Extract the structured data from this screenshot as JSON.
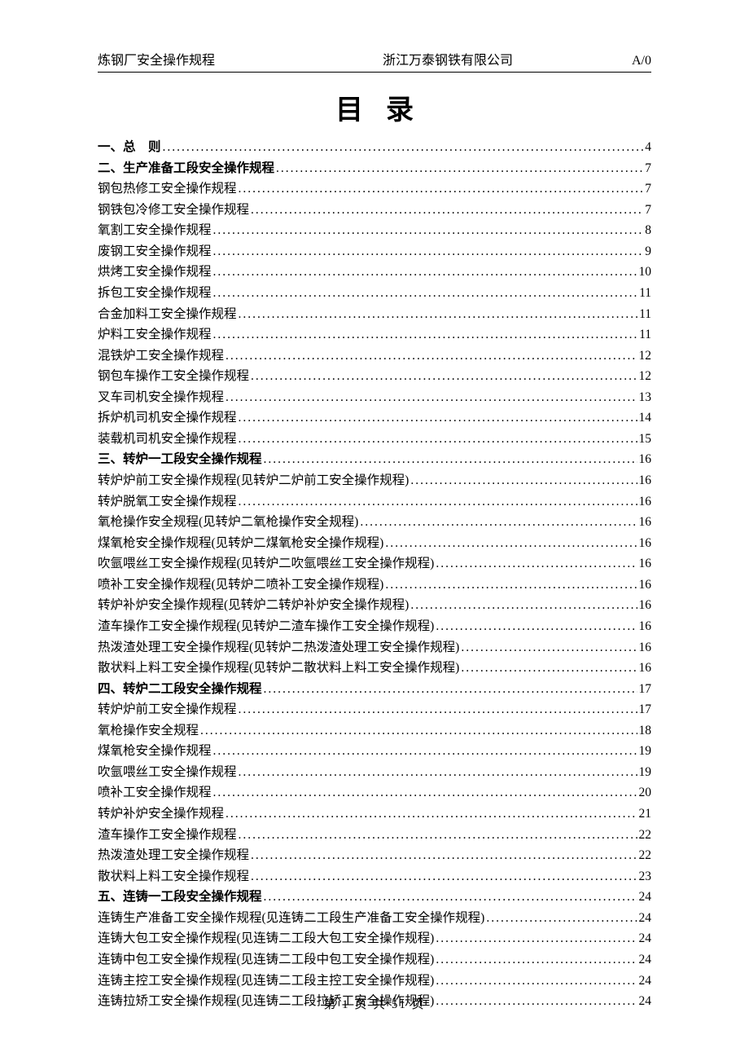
{
  "header": {
    "left": "炼钢厂安全操作规程",
    "center": "浙江万泰钢铁有限公司",
    "right": "A/0"
  },
  "title": "目录",
  "toc": [
    {
      "text": "一、总　则",
      "page": "4",
      "bold": true
    },
    {
      "text": "二、生产准备工段安全操作规程",
      "page": "7",
      "bold": true
    },
    {
      "text": "钢包热修工安全操作规程",
      "page": "7",
      "bold": false
    },
    {
      "text": "钢铁包冷修工安全操作规程",
      "page": "7",
      "bold": false
    },
    {
      "text": "氧割工安全操作规程",
      "page": "8",
      "bold": false
    },
    {
      "text": "废钢工安全操作规程",
      "page": "9",
      "bold": false
    },
    {
      "text": "烘烤工安全操作规程",
      "page": "10",
      "bold": false
    },
    {
      "text": "拆包工安全操作规程",
      "page": "11",
      "bold": false
    },
    {
      "text": "合金加料工安全操作规程",
      "page": "11",
      "bold": false
    },
    {
      "text": "炉料工安全操作规程",
      "page": "11",
      "bold": false
    },
    {
      "text": "混铁炉工安全操作规程",
      "page": "12",
      "bold": false
    },
    {
      "text": "钢包车操作工安全操作规程",
      "page": "12",
      "bold": false
    },
    {
      "text": "叉车司机安全操作规程",
      "page": "13",
      "bold": false
    },
    {
      "text": "拆炉机司机安全操作规程",
      "page": "14",
      "bold": false
    },
    {
      "text": "装载机司机安全操作规程",
      "page": "15",
      "bold": false
    },
    {
      "text": "三、转炉一工段安全操作规程",
      "page": "16",
      "bold": true
    },
    {
      "text": "转炉炉前工安全操作规程(见转炉二炉前工安全操作规程)",
      "page": "16",
      "bold": false
    },
    {
      "text": "转炉脱氧工安全操作规程",
      "page": "16",
      "bold": false
    },
    {
      "text": "氧枪操作安全规程(见转炉二氧枪操作安全规程)",
      "page": "16",
      "bold": false
    },
    {
      "text": "煤氧枪安全操作规程(见转炉二煤氧枪安全操作规程)",
      "page": "16",
      "bold": false
    },
    {
      "text": "吹氩喂丝工安全操作规程(见转炉二吹氩喂丝工安全操作规程)",
      "page": "16",
      "bold": false
    },
    {
      "text": "喷补工安全操作规程(见转炉二喷补工安全操作规程)",
      "page": "16",
      "bold": false
    },
    {
      "text": "转炉补炉安全操作规程(见转炉二转炉补炉安全操作规程)",
      "page": "16",
      "bold": false
    },
    {
      "text": "渣车操作工安全操作规程(见转炉二渣车操作工安全操作规程)",
      "page": "16",
      "bold": false
    },
    {
      "text": "热泼渣处理工安全操作规程(见转炉二热泼渣处理工安全操作规程)",
      "page": "16",
      "bold": false
    },
    {
      "text": "散状料上料工安全操作规程(见转炉二散状料上料工安全操作规程)",
      "page": "16",
      "bold": false
    },
    {
      "text": "四、转炉二工段安全操作规程",
      "page": "17",
      "bold": true
    },
    {
      "text": "转炉炉前工安全操作规程",
      "page": "17",
      "bold": false
    },
    {
      "text": "氧枪操作安全规程",
      "page": "18",
      "bold": false
    },
    {
      "text": "煤氧枪安全操作规程",
      "page": "19",
      "bold": false
    },
    {
      "text": "吹氩喂丝工安全操作规程",
      "page": "19",
      "bold": false
    },
    {
      "text": "喷补工安全操作规程",
      "page": "20",
      "bold": false
    },
    {
      "text": "转炉补炉安全操作规程",
      "page": "21",
      "bold": false
    },
    {
      "text": "渣车操作工安全操作规程",
      "page": "22",
      "bold": false
    },
    {
      "text": "热泼渣处理工安全操作规程",
      "page": "22",
      "bold": false
    },
    {
      "text": "散状料上料工安全操作规程",
      "page": "23",
      "bold": false
    },
    {
      "text": "五、连铸一工段安全操作规程",
      "page": "24",
      "bold": true
    },
    {
      "text": "连铸生产准备工安全操作规程(见连铸二工段生产准备工安全操作规程)",
      "page": "24",
      "bold": false
    },
    {
      "text": "连铸大包工安全操作规程(见连铸二工段大包工安全操作规程)",
      "page": "24",
      "bold": false
    },
    {
      "text": "连铸中包工安全操作规程(见连铸二工段中包工安全操作规程)",
      "page": "24",
      "bold": false
    },
    {
      "text": "连铸主控工安全操作规程(见连铸二工段主控工安全操作规程)",
      "page": "24",
      "bold": false
    },
    {
      "text": "连铸拉矫工安全操作规程(见连铸二工段拉矫工安全操作规程)",
      "page": "24",
      "bold": false
    }
  ],
  "footer": "第 1 页 共 51 页"
}
